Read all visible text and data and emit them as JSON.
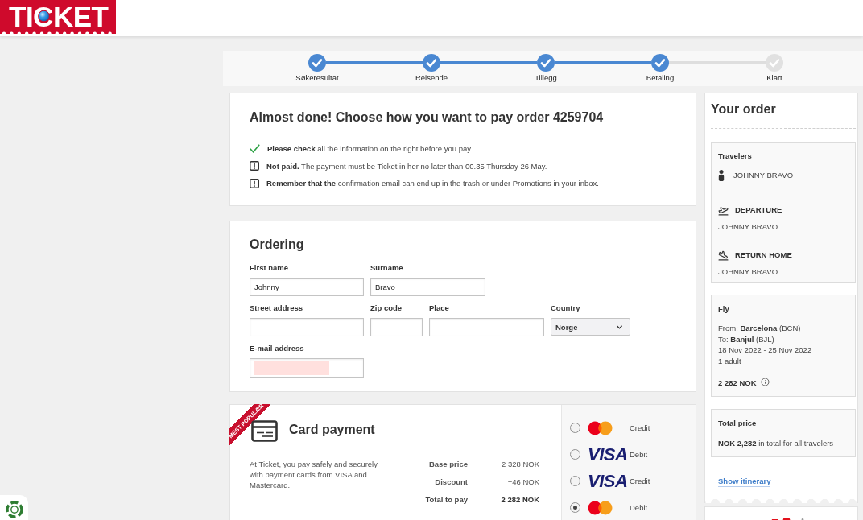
{
  "header": {
    "logo": "TICKET"
  },
  "steps": [
    {
      "label": "Søkeresultat",
      "completed": true
    },
    {
      "label": "Reisende",
      "completed": true
    },
    {
      "label": "Tillegg",
      "completed": true
    },
    {
      "label": "Betaling",
      "completed": true
    },
    {
      "label": "Klart",
      "completed": false
    }
  ],
  "notice": {
    "title": "Almost done! Choose how you want to pay order 4259704",
    "items": [
      {
        "kind": "check",
        "text": "**Please check** all the information on the right before you pay."
      },
      {
        "kind": "warning",
        "text": "**Not paid.** The payment must be Ticket in her no later than 00.35 Thursday 26 May."
      },
      {
        "kind": "warning",
        "text": "**Remember that the** confirmation email can end up in the trash or under Promotions in your inbox."
      }
    ]
  },
  "ordering": {
    "title": "Ordering",
    "field_rows": [
      [
        {
          "label": "First name",
          "kind": "text",
          "value": "Johnny"
        },
        {
          "label": "Surname",
          "kind": "text",
          "value": "Bravo"
        }
      ],
      [
        {
          "label": "Street address",
          "kind": "text"
        },
        {
          "label": "Zip code",
          "kind": "text"
        },
        {
          "label": "Place",
          "kind": "text"
        },
        {
          "label": "Country",
          "kind": "select",
          "value": "Norge"
        }
      ],
      [
        {
          "label": "E-mail address",
          "kind": "redacted"
        }
      ]
    ]
  },
  "payment": {
    "ribbon": "MEST POPULÆR",
    "title": "Card payment",
    "description": "At Ticket, you pay safely and securely with payment cards from VISA and Mastercard.",
    "prices": [
      {
        "kind": "line",
        "label": "Base price",
        "value": "2 328 NOK"
      },
      {
        "kind": "line",
        "label": "Discount",
        "value": "−46 NOK"
      },
      {
        "kind": "total",
        "label": "Total to pay",
        "value": "2 282 NOK"
      }
    ],
    "options": [
      {
        "kind": "mastercard",
        "label": "Credit",
        "selected": false
      },
      {
        "kind": "visa",
        "logo": "VISA",
        "label": "Debit",
        "selected": false
      },
      {
        "kind": "visa",
        "logo": "VISA",
        "label": "Credit",
        "selected": false
      },
      {
        "kind": "mastercard",
        "label": "Debit",
        "selected": true
      }
    ]
  },
  "order": {
    "title": "Your order",
    "travel_sections": [
      {
        "kind": "travelers",
        "heading": "Travelers",
        "name": "JOHNNY BRAVO"
      },
      {
        "kind": "departure",
        "heading": "DEPARTURE",
        "name": "JOHNNY BRAVO"
      },
      {
        "kind": "return",
        "heading": "RETURN HOME",
        "name": "JOHNNY BRAVO"
      }
    ],
    "flight": {
      "heading": "Fly",
      "details": [
        "From: **Barcelona** (BCN)",
        "To: **Banjul** (BJL)",
        "18 Nov 2022 - 25 Nov 2022",
        "1 adult"
      ],
      "price": "2 282 NOK"
    },
    "total": {
      "heading": "Total price",
      "text": "**NOK 2,282** in total for all travelers"
    },
    "link": "Show itinerary"
  }
}
